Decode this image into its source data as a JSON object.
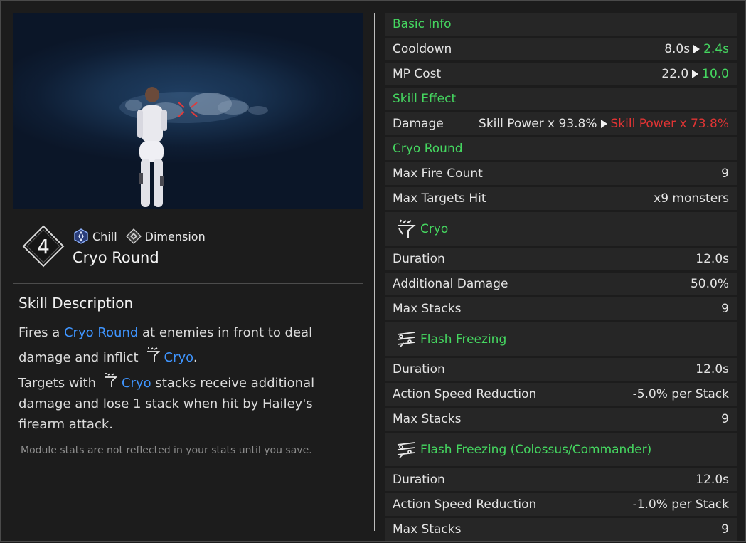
{
  "skill": {
    "rank": "4",
    "tags": [
      {
        "label": "Chill",
        "icon": "chill-icon"
      },
      {
        "label": "Dimension",
        "icon": "dimension-icon"
      }
    ],
    "name": "Cryo Round"
  },
  "description": {
    "title": "Skill Description",
    "p1_a": "Fires a ",
    "p1_hl": "Cryo Round",
    "p1_b": " at enemies in front to deal",
    "p1_c": "damage and inflict",
    "p1_hl2": "Cryo",
    "p1_end": ".",
    "p2_a": "Targets with",
    "p2_hl": "Cryo",
    "p2_b": " stacks receive additional",
    "p2_c": "damage and lose 1 stack when hit by Hailey's",
    "p2_d": "firearm attack."
  },
  "note": "Module stats are not reflected in your stats until you save.",
  "stats": {
    "basic_info": "Basic Info",
    "cooldown": {
      "label": "Cooldown",
      "from": "8.0s",
      "to": "2.4s"
    },
    "mp_cost": {
      "label": "MP Cost",
      "from": "22.0",
      "to": "10.0"
    },
    "skill_effect": "Skill Effect",
    "damage": {
      "label": "Damage",
      "from": "Skill Power x 93.8%",
      "to": "Skill Power x 73.8%"
    },
    "cryo_round": "Cryo Round",
    "max_fire_count": {
      "label": "Max Fire Count",
      "value": "9"
    },
    "max_targets_hit": {
      "label": "Max Targets Hit",
      "value": "x9 monsters"
    },
    "cryo": {
      "title": "Cryo",
      "icon": "cryo-icon",
      "duration": {
        "label": "Duration",
        "value": "12.0s"
      },
      "additional_damage": {
        "label": "Additional Damage",
        "value": "50.0%"
      },
      "max_stacks": {
        "label": "Max Stacks",
        "value": "9"
      }
    },
    "flash_freezing": {
      "title": "Flash Freezing",
      "icon": "flash-freezing-icon",
      "duration": {
        "label": "Duration",
        "value": "12.0s"
      },
      "speed_reduction": {
        "label": "Action Speed Reduction",
        "value": "-5.0% per Stack"
      },
      "max_stacks": {
        "label": "Max Stacks",
        "value": "9"
      }
    },
    "flash_freezing_cc": {
      "title": "Flash Freezing (Colossus/Commander)",
      "icon": "flash-freezing-icon",
      "duration": {
        "label": "Duration",
        "value": "12.0s"
      },
      "speed_reduction": {
        "label": "Action Speed Reduction",
        "value": "-1.0% per Stack"
      },
      "max_stacks": {
        "label": "Max Stacks",
        "value": "9"
      }
    }
  },
  "colors": {
    "green": "#45d760",
    "red": "#e13434",
    "blue": "#3f95ff"
  }
}
